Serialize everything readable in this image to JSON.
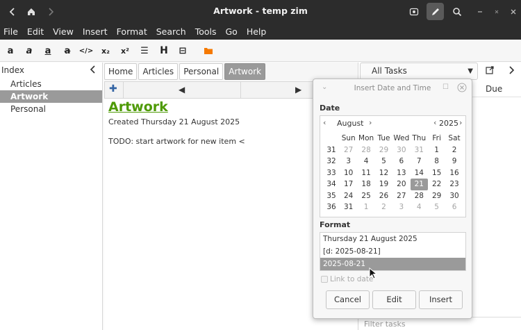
{
  "window": {
    "title": "Artwork - temp zim"
  },
  "menubar": {
    "items": [
      "File",
      "Edit",
      "View",
      "Insert",
      "Format",
      "Search",
      "Tools",
      "Go",
      "Help"
    ]
  },
  "toolbar": {
    "tools": [
      {
        "icon": "bold-icon",
        "glyph": "a"
      },
      {
        "icon": "italic-icon",
        "glyph": "a"
      },
      {
        "icon": "underline-icon",
        "glyph": "a"
      },
      {
        "icon": "strikethrough-icon",
        "glyph": "a"
      },
      {
        "icon": "code-icon",
        "glyph": "</>"
      },
      {
        "icon": "subscript-icon",
        "glyph": "x₂"
      },
      {
        "icon": "superscript-icon",
        "glyph": "x²"
      },
      {
        "icon": "bullet-list-icon",
        "glyph": "☰"
      },
      {
        "icon": "heading-icon",
        "glyph": "H"
      },
      {
        "icon": "verbatim-icon",
        "glyph": "⊟"
      },
      {
        "icon": "folder-icon",
        "glyph": "▬"
      }
    ]
  },
  "index": {
    "header": "Index",
    "items": [
      {
        "label": "Articles",
        "selected": false
      },
      {
        "label": "Artwork",
        "selected": true
      },
      {
        "label": "Personal",
        "selected": false
      }
    ]
  },
  "pathbar": {
    "items": [
      {
        "label": "Home",
        "active": false
      },
      {
        "label": "Articles",
        "active": false
      },
      {
        "label": "Personal",
        "active": false
      },
      {
        "label": "Artwork",
        "active": true
      }
    ]
  },
  "page": {
    "title": "Artwork",
    "created": "Created Thursday 21 August 2025",
    "todo": "TODO: start artwork for new item <"
  },
  "tasks": {
    "selector": "All Tasks",
    "due_header": "Due",
    "filter_placeholder": "Filter tasks"
  },
  "dialog": {
    "title": "Insert Date and Time",
    "date_label": "Date",
    "month": "August",
    "year": "2025",
    "weekday_headers": [
      "Sun",
      "Mon",
      "Tue",
      "Wed",
      "Thu",
      "Fri",
      "Sat"
    ],
    "weeks": [
      {
        "week": "31",
        "days": [
          {
            "d": "27",
            "dim": true
          },
          {
            "d": "28",
            "dim": true
          },
          {
            "d": "29",
            "dim": true
          },
          {
            "d": "30",
            "dim": true
          },
          {
            "d": "31",
            "dim": true
          },
          {
            "d": "1"
          },
          {
            "d": "2"
          }
        ]
      },
      {
        "week": "32",
        "days": [
          {
            "d": "3"
          },
          {
            "d": "4"
          },
          {
            "d": "5"
          },
          {
            "d": "6"
          },
          {
            "d": "7"
          },
          {
            "d": "8"
          },
          {
            "d": "9"
          }
        ]
      },
      {
        "week": "33",
        "days": [
          {
            "d": "10"
          },
          {
            "d": "11"
          },
          {
            "d": "12"
          },
          {
            "d": "13"
          },
          {
            "d": "14"
          },
          {
            "d": "15"
          },
          {
            "d": "16"
          }
        ]
      },
      {
        "week": "34",
        "days": [
          {
            "d": "17"
          },
          {
            "d": "18"
          },
          {
            "d": "19"
          },
          {
            "d": "20"
          },
          {
            "d": "21",
            "selected": true
          },
          {
            "d": "22"
          },
          {
            "d": "23"
          }
        ]
      },
      {
        "week": "35",
        "days": [
          {
            "d": "24"
          },
          {
            "d": "25"
          },
          {
            "d": "26"
          },
          {
            "d": "27"
          },
          {
            "d": "28"
          },
          {
            "d": "29"
          },
          {
            "d": "30"
          }
        ]
      },
      {
        "week": "36",
        "days": [
          {
            "d": "31"
          },
          {
            "d": "1",
            "dim": true
          },
          {
            "d": "2",
            "dim": true
          },
          {
            "d": "3",
            "dim": true
          },
          {
            "d": "4",
            "dim": true
          },
          {
            "d": "5",
            "dim": true
          },
          {
            "d": "6",
            "dim": true
          }
        ]
      }
    ],
    "format_label": "Format",
    "formats": [
      {
        "label": "Thursday 21 August 2025",
        "selected": false
      },
      {
        "label": "[d: 2025-08-21]",
        "selected": false
      },
      {
        "label": "2025-08-21",
        "selected": true
      }
    ],
    "link_checkbox": "Link to date",
    "buttons": {
      "cancel": "Cancel",
      "edit": "Edit",
      "insert": "Insert"
    }
  },
  "colors": {
    "titlebar": "#2c2c2c",
    "selection": "#9a9a9a",
    "page_title": "#4e9a06",
    "folder_icon": "#f57900"
  }
}
